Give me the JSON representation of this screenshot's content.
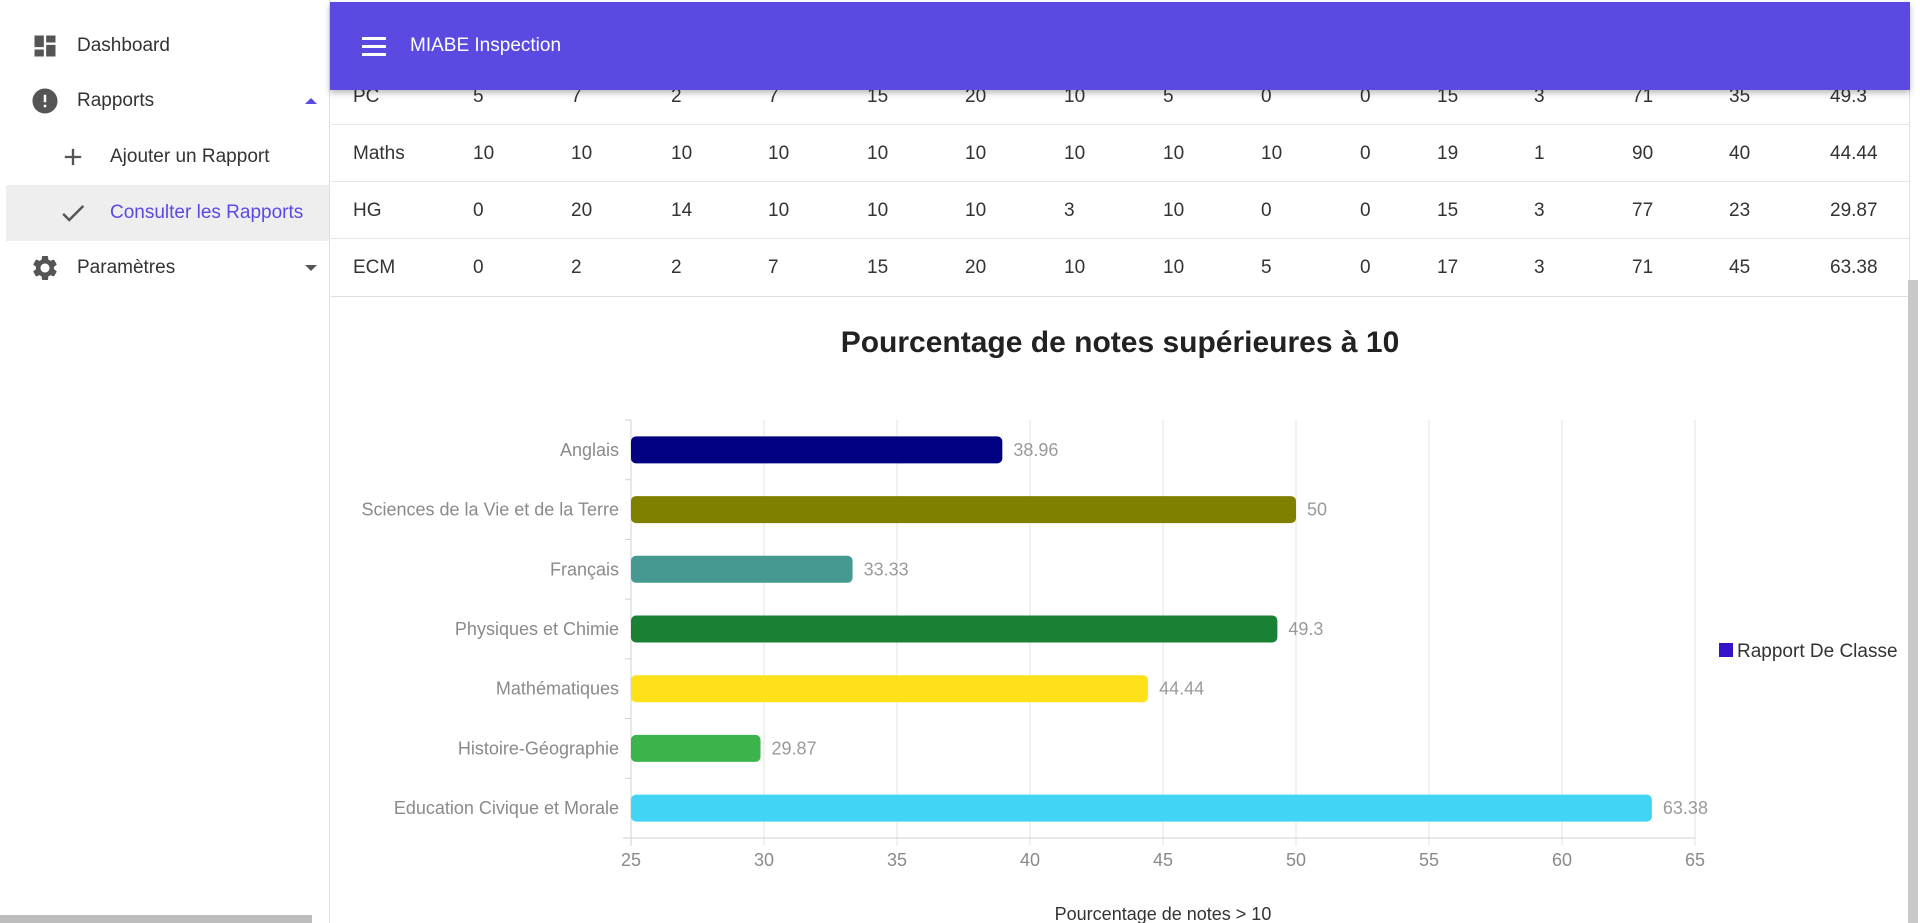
{
  "sidebar": {
    "items": [
      {
        "label": "Dashboard",
        "icon": "dashboard-icon"
      },
      {
        "label": "Rapports",
        "icon": "alert-circle-icon",
        "expanded": true
      },
      {
        "label": "Ajouter un Rapport",
        "icon": "plus-icon"
      },
      {
        "label": "Consulter les Rapports",
        "icon": "check-icon",
        "active": true
      },
      {
        "label": "Paramètres",
        "icon": "gear-icon",
        "expanded": false
      }
    ]
  },
  "appbar": {
    "title": "MIABE Inspection",
    "color": "#5b4ae2"
  },
  "table": {
    "rows": [
      [
        "PC",
        "5",
        "7",
        "2",
        "7",
        "15",
        "20",
        "10",
        "5",
        "0",
        "0",
        "15",
        "3",
        "71",
        "35",
        "49.3"
      ],
      [
        "Maths",
        "10",
        "10",
        "10",
        "10",
        "10",
        "10",
        "10",
        "10",
        "10",
        "0",
        "19",
        "1",
        "90",
        "40",
        "44.44"
      ],
      [
        "HG",
        "0",
        "20",
        "14",
        "10",
        "10",
        "10",
        "3",
        "10",
        "0",
        "0",
        "15",
        "3",
        "77",
        "23",
        "29.87"
      ],
      [
        "ECM",
        "0",
        "2",
        "2",
        "7",
        "15",
        "20",
        "10",
        "10",
        "5",
        "0",
        "17",
        "3",
        "71",
        "45",
        "63.38"
      ]
    ]
  },
  "chart_data": {
    "type": "bar",
    "orientation": "horizontal",
    "title": "Pourcentage de notes supérieures à 10",
    "xlabel": "Pourcentage de notes > 10",
    "ylabel": "",
    "xlim": [
      25,
      65
    ],
    "xticks": [
      25,
      30,
      35,
      40,
      45,
      50,
      55,
      60,
      65
    ],
    "categories": [
      "Anglais",
      "Sciences de la Vie et de la Terre",
      "Français",
      "Physiques et Chimie",
      "Mathématiques",
      "Histoire-Géographie",
      "Education Civique et Morale"
    ],
    "values": [
      38.96,
      50,
      33.33,
      49.3,
      44.44,
      29.87,
      63.38
    ],
    "data_labels": [
      "38.96",
      "50",
      "33.33",
      "49.3",
      "44.44",
      "29.87",
      "63.38"
    ],
    "colors": [
      "#000080",
      "#808000",
      "#469990",
      "#1a8134",
      "#ffe119",
      "#3cb44b",
      "#42d4f4"
    ],
    "legend": {
      "label": "Rapport De Classe",
      "color": "#3612c9",
      "placement": "right"
    },
    "grid": true
  }
}
